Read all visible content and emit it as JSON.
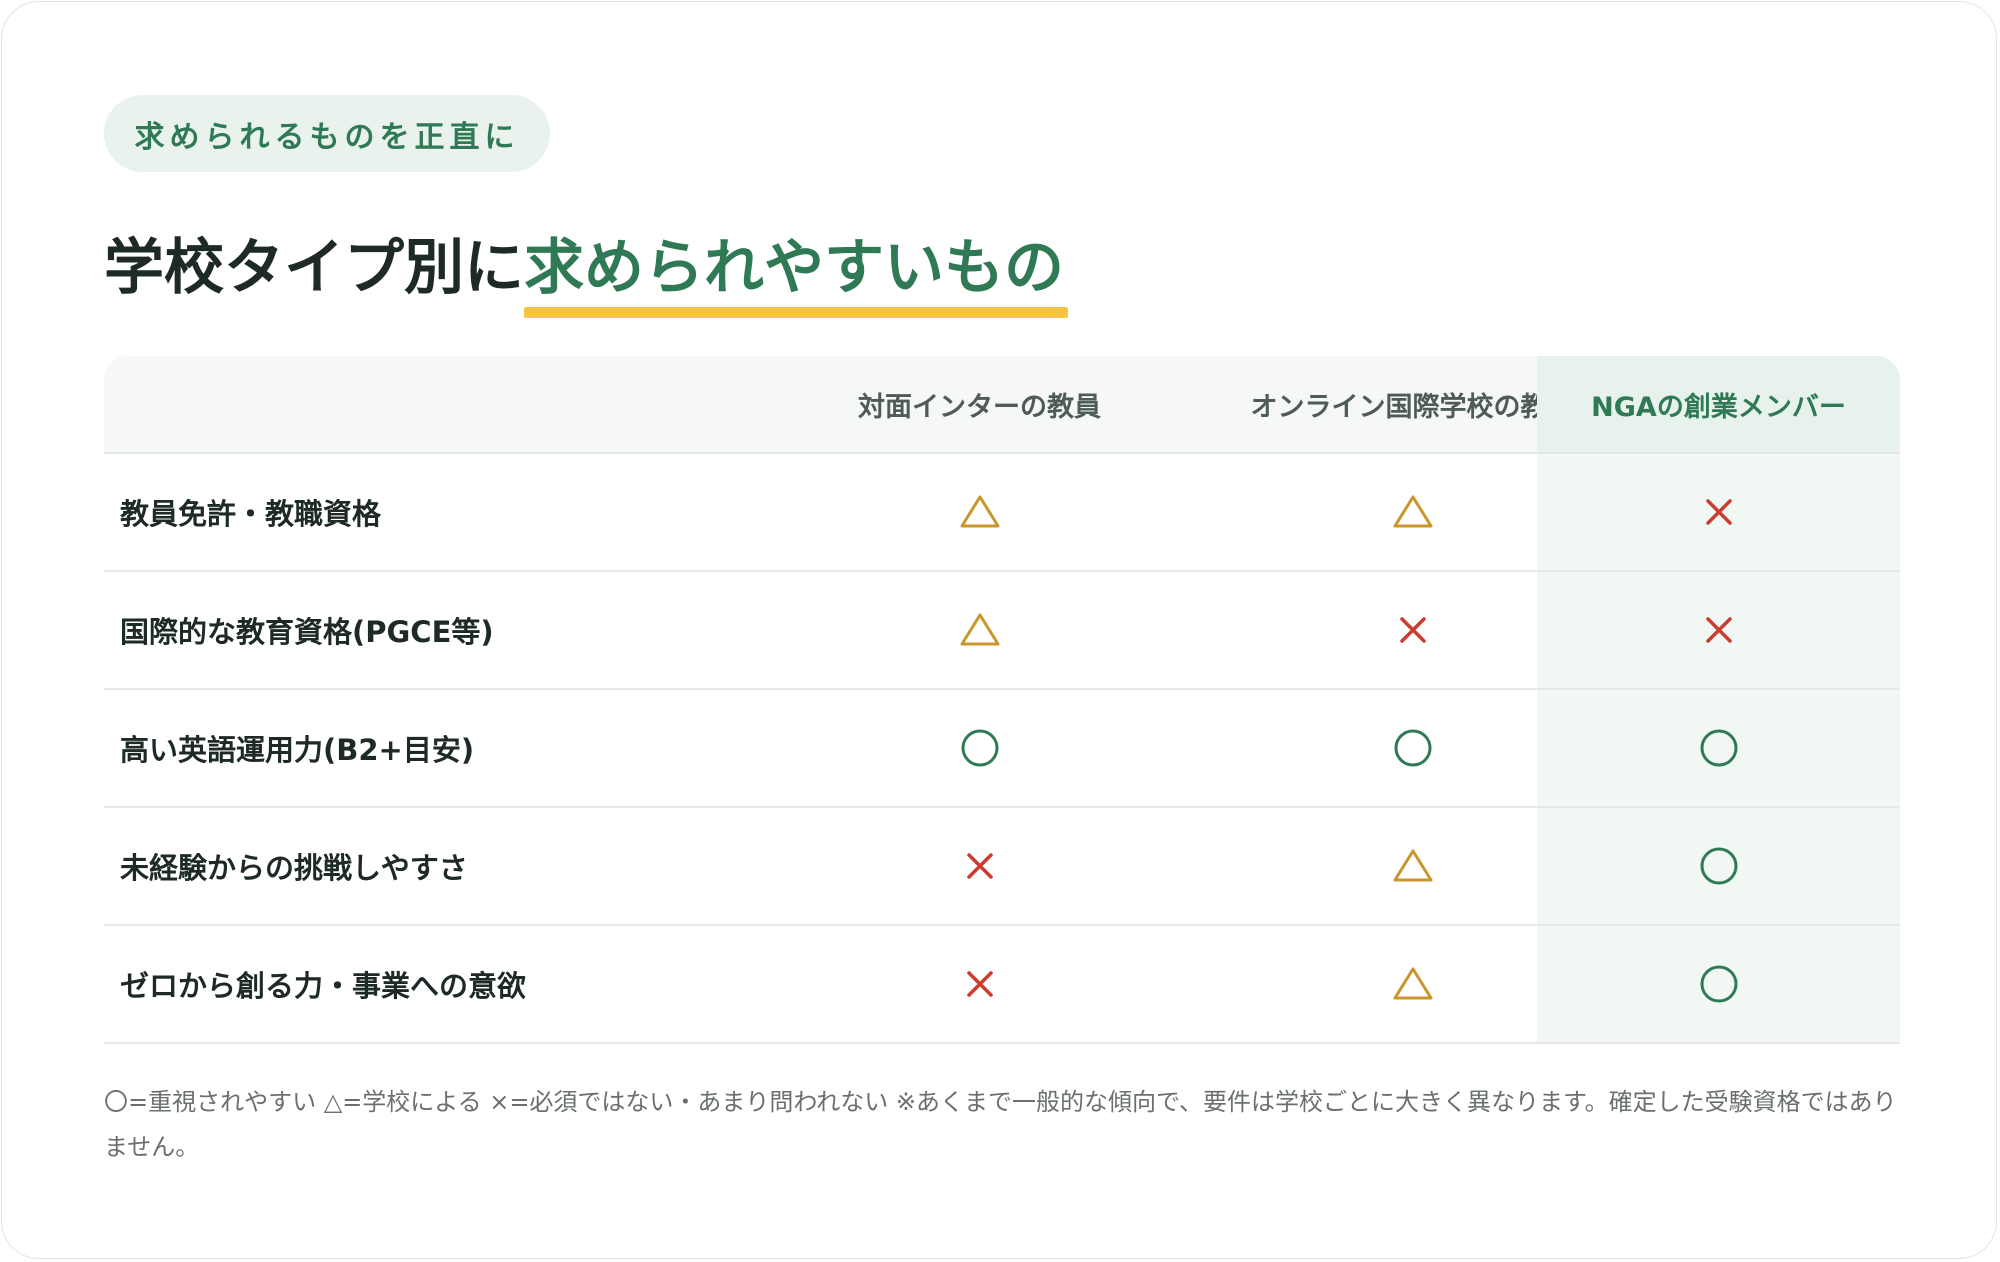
{
  "badge": "求められるものを正直に",
  "title": {
    "prefix": "学校タイプ別に",
    "accent": "求められやすいもの"
  },
  "table": {
    "columns": [
      "対面インターの教員",
      "オンライン国際学校の教員",
      "NGAの創業メンバー"
    ],
    "rows": [
      {
        "label": "教員免許・教職資格",
        "marks": [
          "triangle",
          "triangle",
          "cross"
        ]
      },
      {
        "label": "国際的な教育資格(PGCE等)",
        "marks": [
          "triangle",
          "cross",
          "cross"
        ]
      },
      {
        "label": "高い英語運用力(B2+目安)",
        "marks": [
          "circle",
          "circle",
          "circle"
        ]
      },
      {
        "label": "未経験からの挑戦しやすさ",
        "marks": [
          "cross",
          "triangle",
          "circle"
        ]
      },
      {
        "label": "ゼロから創る力・事業への意欲",
        "marks": [
          "cross",
          "triangle",
          "circle"
        ]
      }
    ]
  },
  "footnote": "〇=重視されやすい △=学校による ×=必須ではない・あまり問われない ※あくまで一般的な傾向で、要件は学校ごとに大きく異なります。確定した受験資格ではありません。",
  "colors": {
    "accent": "#2f7a55",
    "highlight": "#f6c344",
    "triangle": "#c9962b",
    "cross": "#cc3b30",
    "circle": "#2f7a55"
  }
}
